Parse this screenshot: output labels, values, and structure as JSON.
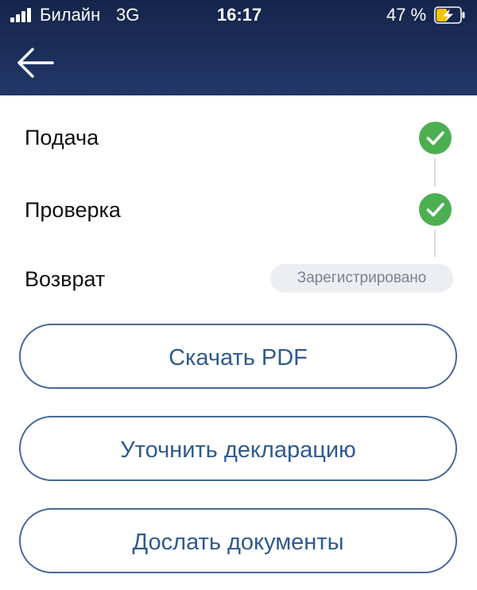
{
  "status_bar": {
    "carrier": "Билайн",
    "network": "3G",
    "time": "16:17",
    "battery_percent": "47 %",
    "battery_level": 0.47,
    "charging": true,
    "battery_icon": "battery-charging-icon",
    "battery_color": "#f5c400"
  },
  "header": {
    "back_icon": "arrow-left-icon"
  },
  "steps": [
    {
      "label": "Подача",
      "status": "done",
      "icon": "check-circle-icon"
    },
    {
      "label": "Проверка",
      "status": "done",
      "icon": "check-circle-icon"
    },
    {
      "label": "Возврат",
      "status": "Зарегистрировано"
    }
  ],
  "actions": {
    "download_pdf": "Скачать PDF",
    "clarify_declaration": "Уточнить декларацию",
    "send_documents": "Дослать документы"
  },
  "colors": {
    "header": "#1b2f5b",
    "success": "#4caf50",
    "button_border": "#46699a",
    "button_text": "#2f5a8f",
    "badge_bg": "#eceef2",
    "badge_text": "#7b8190"
  }
}
